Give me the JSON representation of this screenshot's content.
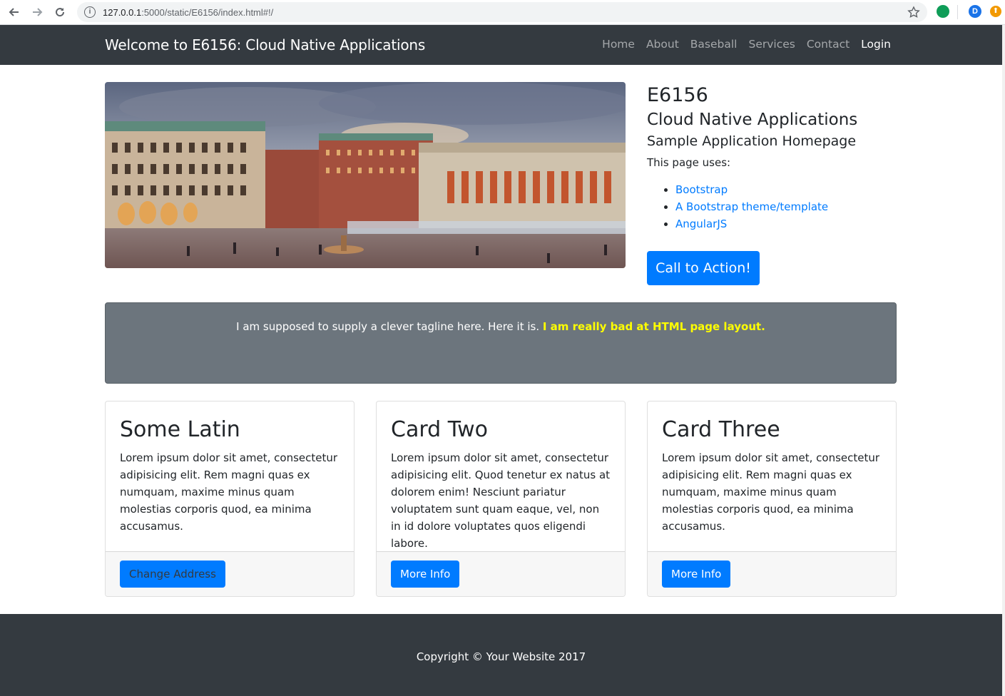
{
  "browser": {
    "url_host": "127.0.0.1",
    "url_rest": ":5000/static/E6156/index.html#!/",
    "profile_initial": "D"
  },
  "navbar": {
    "brand": "Welcome to E6156: Cloud Native Applications",
    "links": [
      "Home",
      "About",
      "Baseball",
      "Services",
      "Contact"
    ],
    "login": "Login"
  },
  "intro": {
    "h1": "E6156",
    "h2": "Cloud Native Applications",
    "h3": "Sample Application Homepage",
    "uses_label": "This page uses:",
    "uses": [
      "Bootstrap",
      "A Bootstrap theme/template",
      "AngularJS"
    ],
    "cta": "Call to Action!"
  },
  "tagline": {
    "text": "I am supposed to supply a clever tagline here. Here it is. ",
    "highlight": "I am really bad at HTML page layout."
  },
  "cards": [
    {
      "title": "Some Latin",
      "text": "Lorem ipsum dolor sit amet, consectetur adipisicing elit. Rem magni quas ex numquam, maxime minus quam molestias corporis quod, ea minima accusamus.",
      "button": "Change Address"
    },
    {
      "title": "Card Two",
      "text": "Lorem ipsum dolor sit amet, consectetur adipisicing elit. Quod tenetur ex natus at dolorem enim! Nesciunt pariatur voluptatem sunt quam eaque, vel, non in id dolore voluptates quos eligendi labore.",
      "button": "More Info"
    },
    {
      "title": "Card Three",
      "text": "Lorem ipsum dolor sit amet, consectetur adipisicing elit. Rem magni quas ex numquam, maxime minus quam molestias corporis quod, ea minima accusamus.",
      "button": "More Info"
    }
  ],
  "footer": {
    "copyright": "Copyright © Your Website 2017"
  },
  "colors": {
    "navbar_bg": "#343a40",
    "primary": "#007bff",
    "tagline_bg": "#6c757d",
    "highlight": "#ffff00"
  }
}
